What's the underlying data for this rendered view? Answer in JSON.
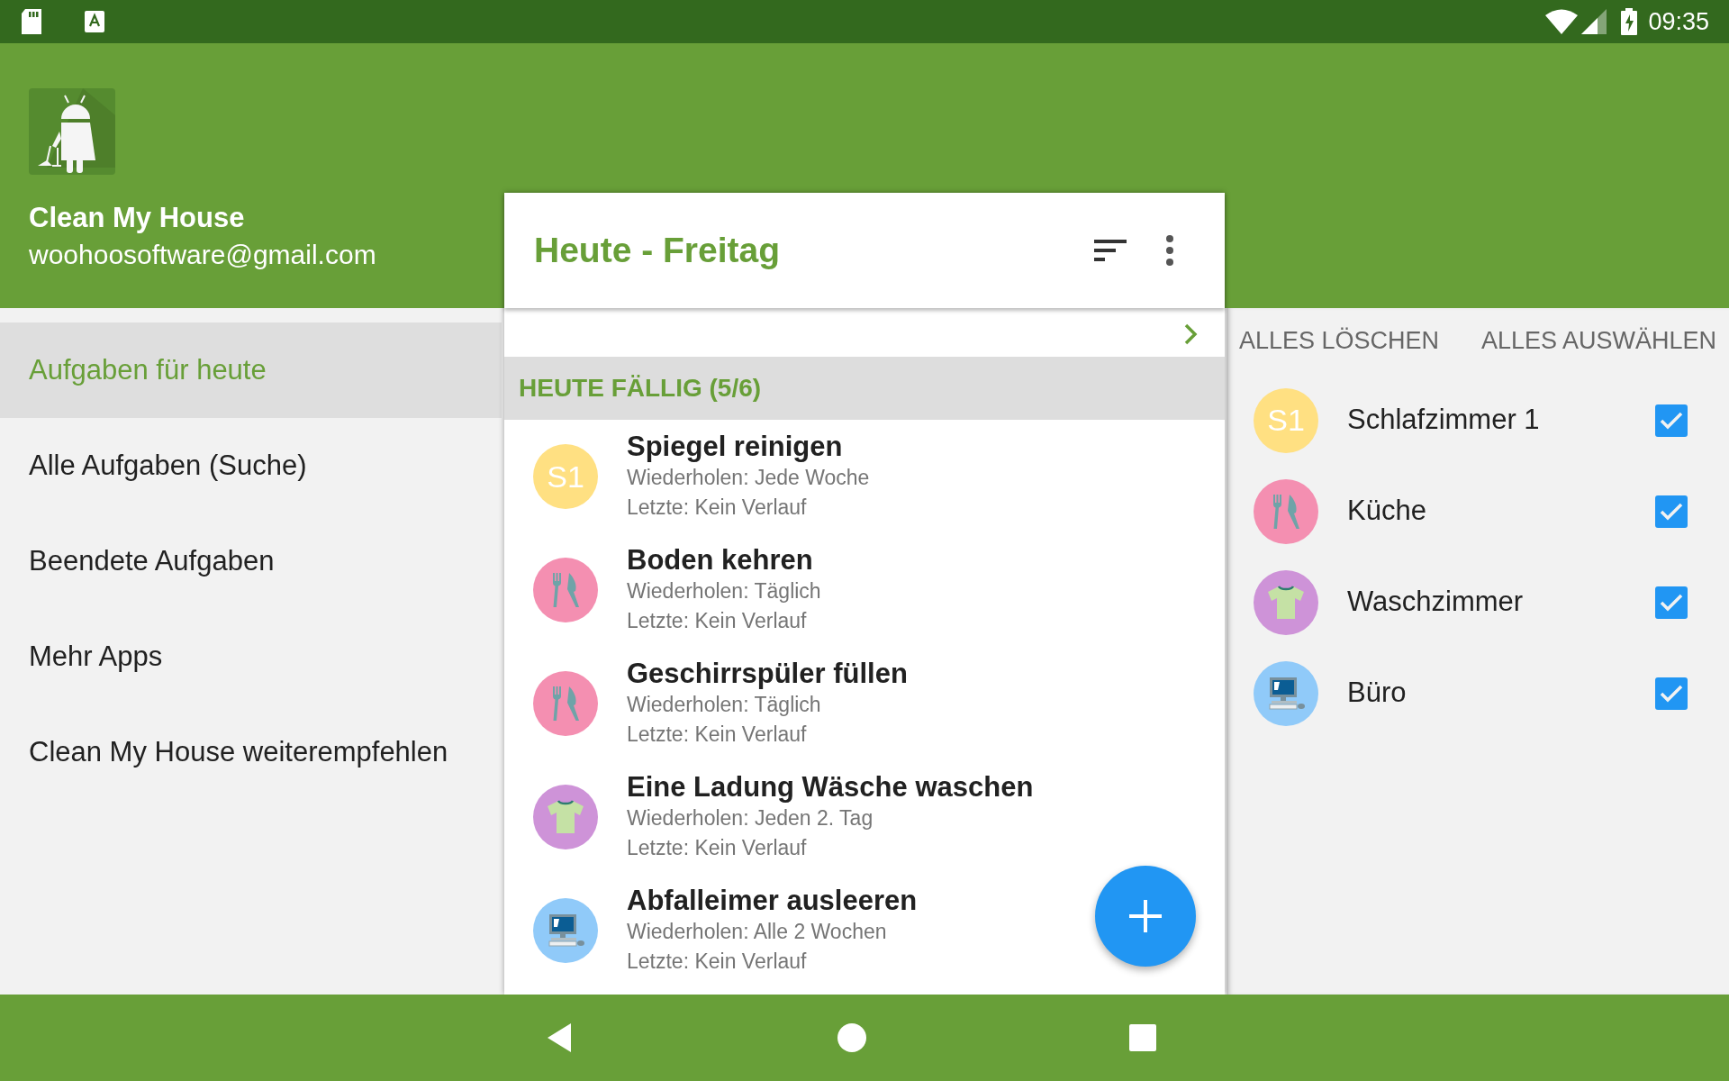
{
  "status_bar": {
    "time": "09:35"
  },
  "drawer": {
    "app_name": "Clean My House",
    "email": "woohoosoftware@gmail.com",
    "items": [
      {
        "label": "Aufgaben für heute",
        "selected": true
      },
      {
        "label": "Alle Aufgaben (Suche)",
        "selected": false
      },
      {
        "label": "Beendete Aufgaben",
        "selected": false
      },
      {
        "label": "Mehr Apps",
        "selected": false
      },
      {
        "label": "Clean My House weiterempfehlen",
        "selected": false
      }
    ]
  },
  "toolbar": {
    "title": "Heute - Freitag"
  },
  "section": {
    "title": "HEUTE FÄLLIG (5/6)"
  },
  "tasks": [
    {
      "title": "Spiegel reinigen",
      "repeat": "Wiederholen: Jede Woche",
      "last": "Letzte: Kein Verlauf",
      "avatar": {
        "kind": "initials",
        "text": "S1",
        "color": "#ffe082"
      }
    },
    {
      "title": "Boden kehren",
      "repeat": "Wiederholen: Täglich",
      "last": "Letzte: Kein Verlauf",
      "avatar": {
        "kind": "cutlery",
        "color": "#f48fb1"
      }
    },
    {
      "title": "Geschirrspüler füllen",
      "repeat": "Wiederholen: Täglich",
      "last": "Letzte: Kein Verlauf",
      "avatar": {
        "kind": "cutlery",
        "color": "#f48fb1"
      }
    },
    {
      "title": "Eine Ladung Wäsche waschen",
      "repeat": "Wiederholen: Jeden 2. Tag",
      "last": "Letzte: Kein Verlauf",
      "avatar": {
        "kind": "shirt",
        "color": "#ce93d8"
      }
    },
    {
      "title": "Abfalleimer ausleeren",
      "repeat": "Wiederholen: Alle 2 Wochen",
      "last": "Letzte: Kein Verlauf",
      "avatar": {
        "kind": "computer",
        "color": "#90caf9"
      }
    }
  ],
  "filter_panel": {
    "clear_button": "ALLES LÖSCHEN",
    "select_all_button": "ALLES AUSWÄHLEN",
    "rooms": [
      {
        "name": "Schlafzimmer 1",
        "checked": true,
        "avatar": {
          "kind": "initials",
          "text": "S1",
          "color": "#ffe082"
        }
      },
      {
        "name": "Küche",
        "checked": true,
        "avatar": {
          "kind": "cutlery",
          "color": "#f48fb1"
        }
      },
      {
        "name": "Waschzimmer",
        "checked": true,
        "avatar": {
          "kind": "shirt",
          "color": "#ce93d8"
        }
      },
      {
        "name": "Büro",
        "checked": true,
        "avatar": {
          "kind": "computer",
          "color": "#90caf9"
        }
      }
    ]
  }
}
